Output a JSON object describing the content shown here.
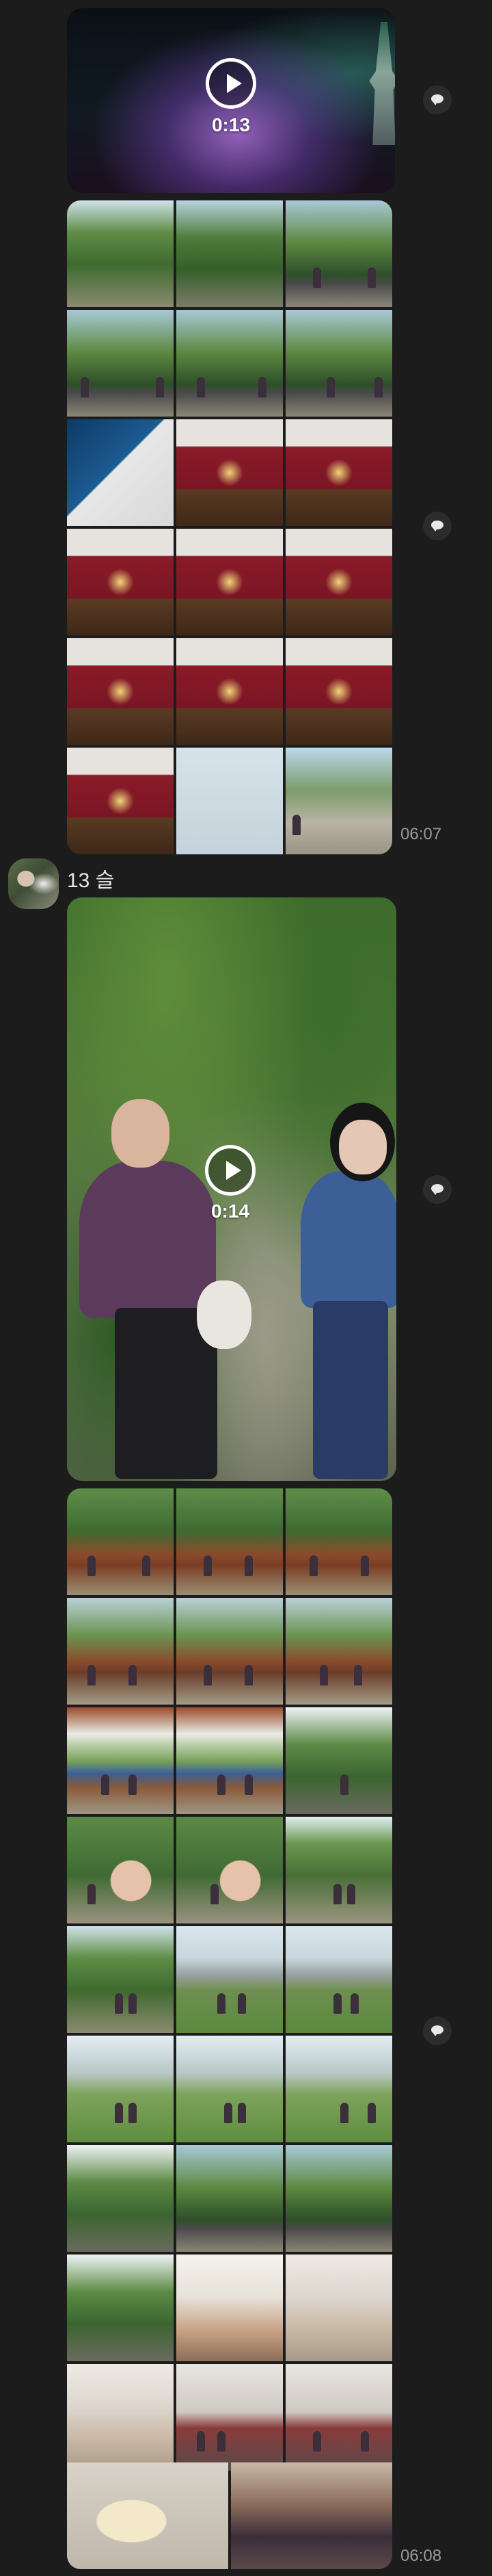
{
  "thread": {
    "video1": {
      "duration": "0:13"
    },
    "album1": {
      "timestamp": "06:07",
      "photo_count": 18
    },
    "sender": {
      "name": "13 슬"
    },
    "video2": {
      "duration": "0:14"
    },
    "album2": {
      "timestamp": "06:08",
      "photo_count": 29
    }
  },
  "icons": {
    "play": "play-icon",
    "reply": "reply-bubble-icon"
  },
  "colors": {
    "background": "#1c1c1c",
    "timestamp": "#9a9a9a",
    "text": "#e6e6e6"
  }
}
